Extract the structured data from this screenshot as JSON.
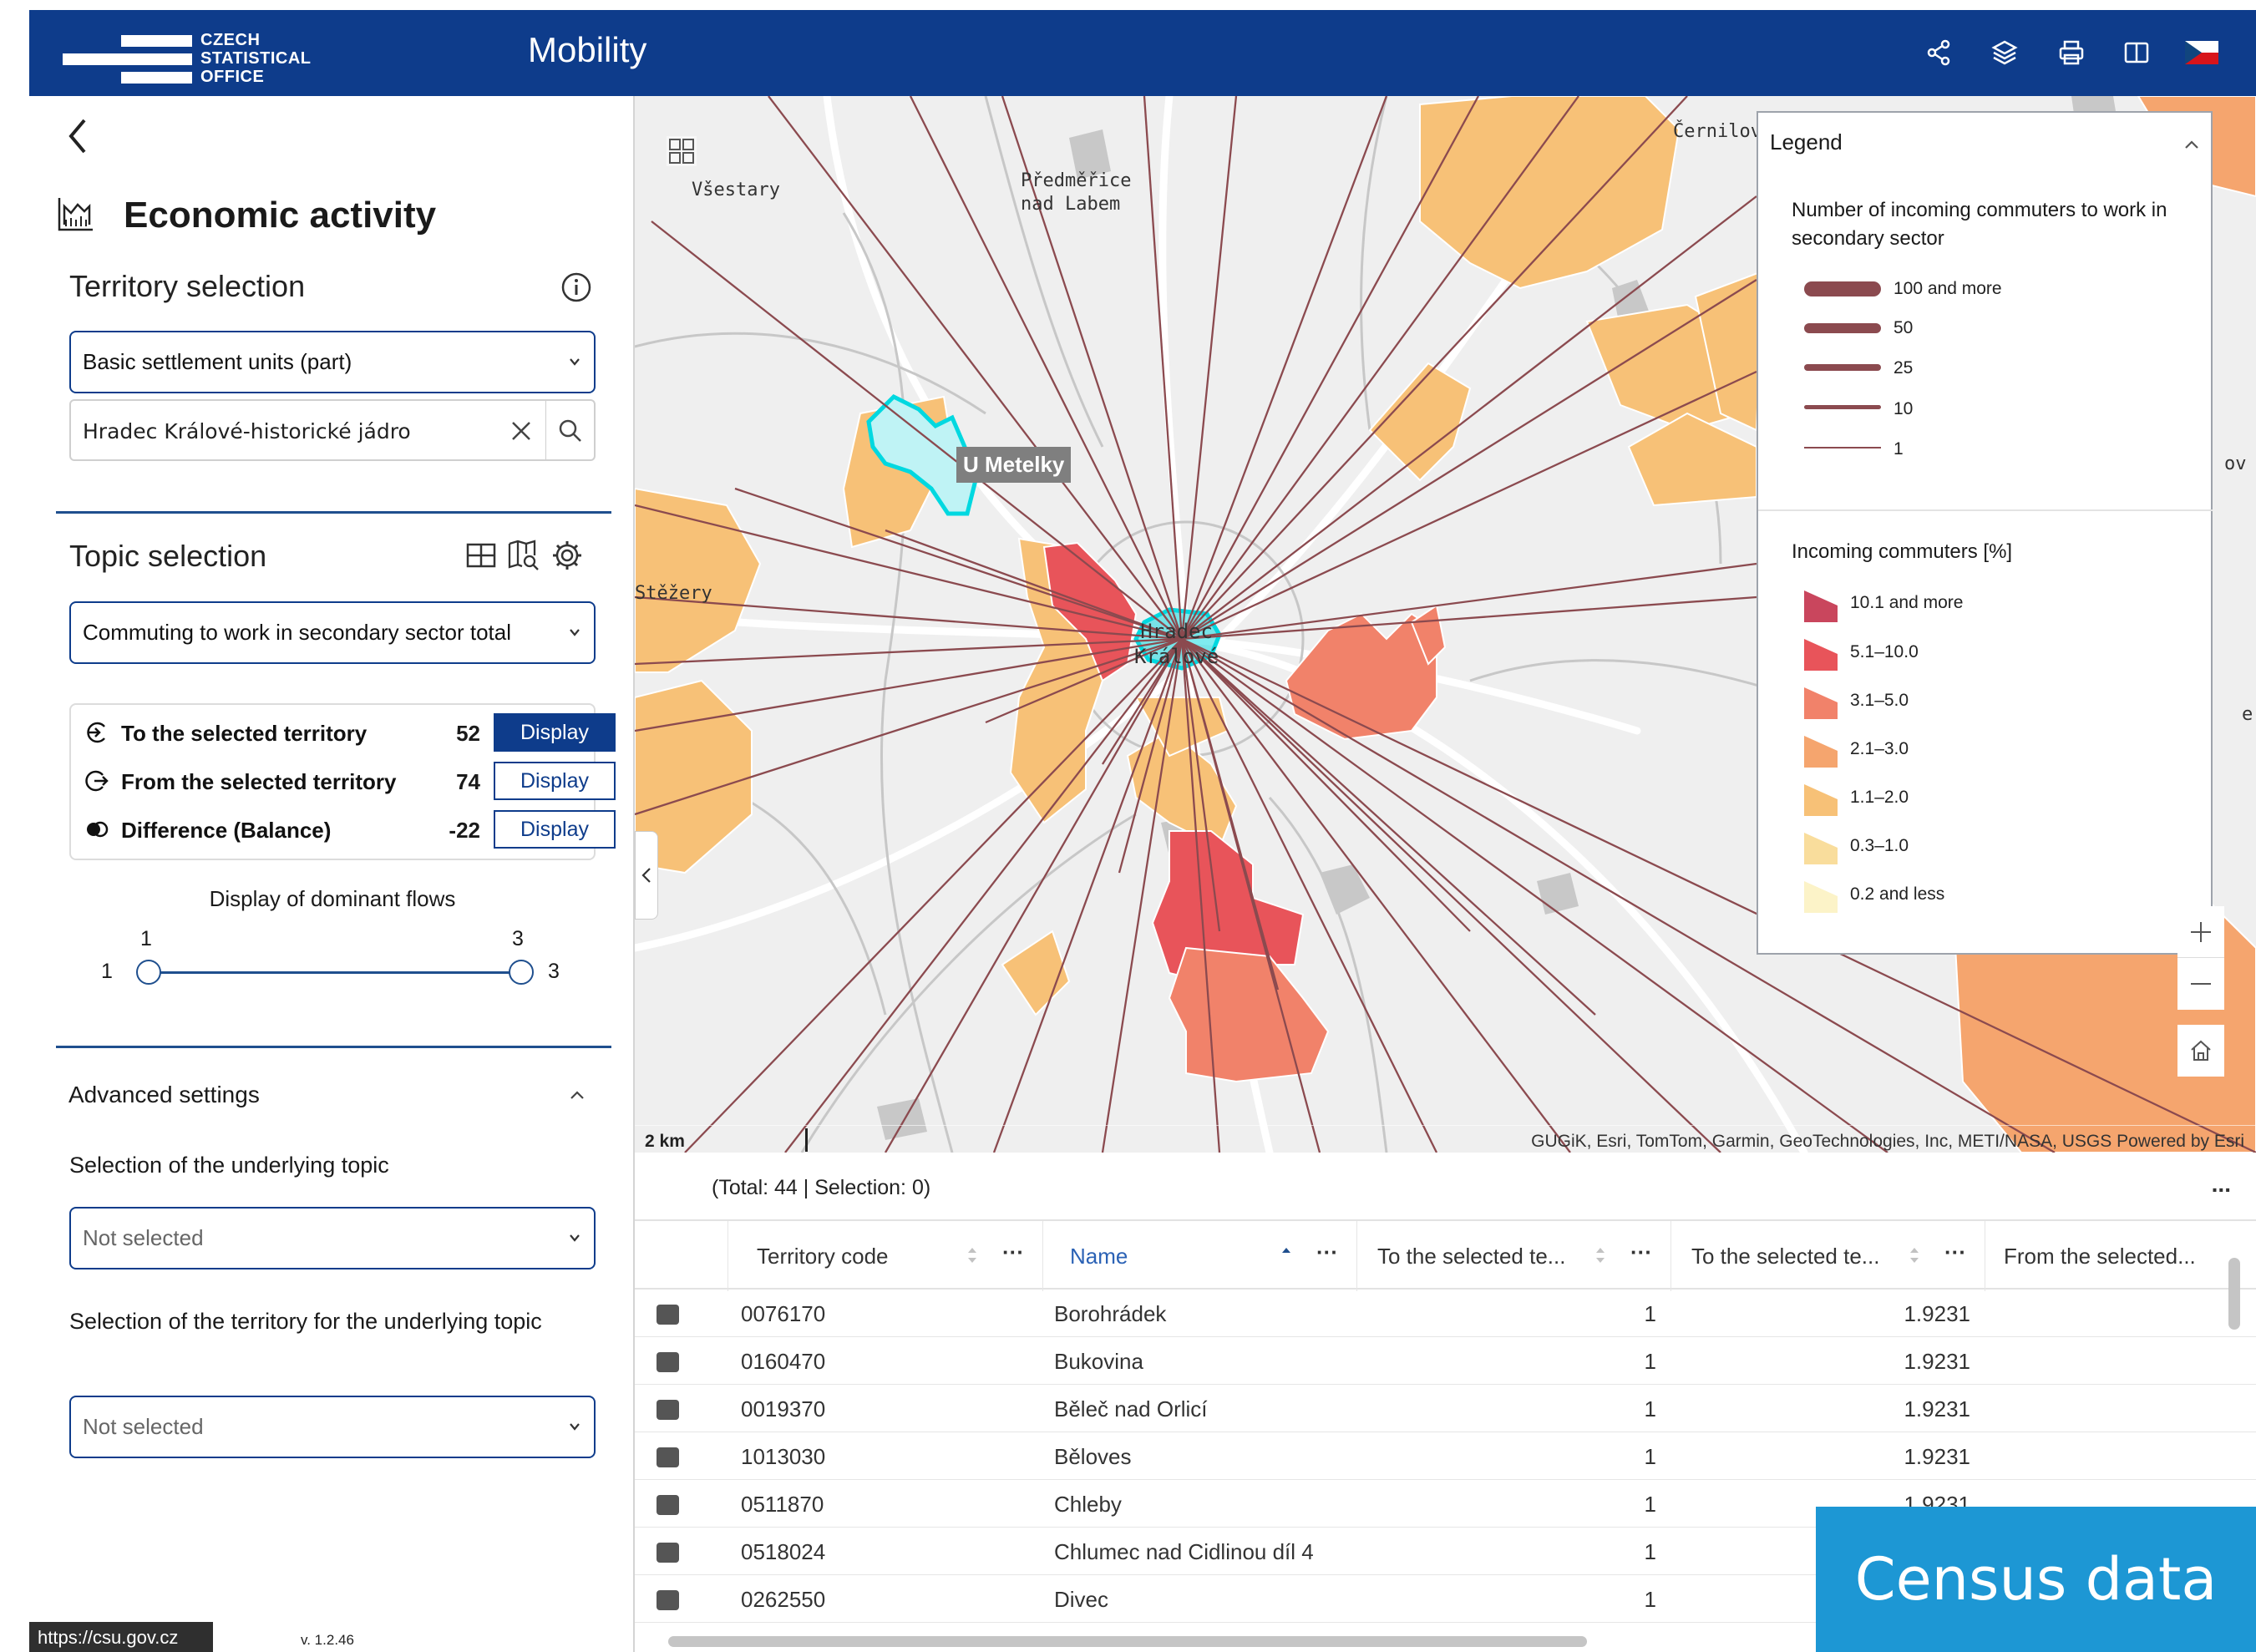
{
  "header": {
    "logo_lines": [
      "CZECH",
      "STATISTICAL",
      "OFFICE"
    ],
    "title": "Mobility",
    "icons": [
      "share-icon",
      "layers-icon",
      "print-icon",
      "book-icon",
      "czech-flag-icon"
    ]
  },
  "left_panel": {
    "back_icon": "chevron-left-icon",
    "heading": "Economic activity",
    "territory_selection": {
      "title": "Territory selection",
      "level_select": "Basic settlement units (part)",
      "search_value": "Hradec Králové-historické jádro"
    },
    "topic_selection": {
      "title": "Topic selection",
      "topic_select": "Commuting to work in secondary sector total",
      "flows": [
        {
          "label": "To the selected territory",
          "value": "52",
          "button": "Display",
          "active": true
        },
        {
          "label": "From the selected territory",
          "value": "74",
          "button": "Display",
          "active": false
        },
        {
          "label": "Difference (Balance)",
          "value": "-22",
          "button": "Display",
          "active": false
        }
      ],
      "dominant_flows": {
        "label": "Display of dominant flows",
        "min": "1",
        "max": "3",
        "low_value": "1",
        "high_value": "3",
        "low_fraction": 0,
        "high_fraction": 1
      }
    },
    "advanced": {
      "title": "Advanced settings",
      "underlying_topic_label": "Selection of the underlying topic",
      "underlying_topic_value": "Not selected",
      "underlying_territory_label": "Selection of the territory for the underlying topic",
      "underlying_territory_value": "Not selected"
    },
    "status_url": "https://csu.gov.cz",
    "version": "v. 1.2.46"
  },
  "map": {
    "places": {
      "vsestary": "Všestary",
      "predmerice": "Předměřice\nnad Labem",
      "cernilov": "Černilov",
      "stezery": "Stěžery",
      "hradec": "Hradec\nKrálové",
      "ov": "ov",
      "e_edge": "e"
    },
    "tooltip": "U Metelky",
    "scale_label": "2 km",
    "attribution": "GUGiK, Esri, TomTom, Garmin, GeoTechnologies, Inc, METI/NASA, USGS   Powered by Esri",
    "legend": {
      "title": "Legend",
      "lines_title": "Number of incoming commuters to work in secondary sector",
      "line_classes": [
        "100 and more",
        "50",
        "25",
        "10",
        "1"
      ],
      "fill_title": "Incoming commuters [%]",
      "fill_classes": [
        "10.1 and more",
        "5.1–10.0",
        "3.1–5.0",
        "2.1–3.0",
        "1.1–2.0",
        "0.3–1.0",
        "0.2 and less"
      ],
      "fill_colors": [
        "#c9465d",
        "#e8545a",
        "#f1826a",
        "#f5a56e",
        "#f7c177",
        "#f9dd9c",
        "#fcf3c8"
      ],
      "line_color": "#8b4a4f"
    },
    "controls": [
      "zoom-in-icon",
      "zoom-out-icon",
      "home-icon"
    ]
  },
  "table": {
    "summary": "(Total: 44 | Selection: 0)",
    "more": "...",
    "columns": [
      "Territory code",
      "Name",
      "To the selected te...",
      "To the selected te...",
      "From the selected..."
    ],
    "rows": [
      {
        "code": "0076170",
        "name": "Borohrádek",
        "to_count": "1",
        "to_pct": "1.9231"
      },
      {
        "code": "0160470",
        "name": "Bukovina",
        "to_count": "1",
        "to_pct": "1.9231"
      },
      {
        "code": "0019370",
        "name": "Běleč nad Orlicí",
        "to_count": "1",
        "to_pct": "1.9231"
      },
      {
        "code": "1013030",
        "name": "Běloves",
        "to_count": "1",
        "to_pct": "1.9231"
      },
      {
        "code": "0511870",
        "name": "Chleby",
        "to_count": "1",
        "to_pct": "1.9231"
      },
      {
        "code": "0518024",
        "name": "Chlumec nad Cidlinou díl 4",
        "to_count": "1",
        "to_pct": ""
      },
      {
        "code": "0262550",
        "name": "Divec",
        "to_count": "1",
        "to_pct": ""
      }
    ]
  },
  "census_badge": "Census data",
  "colors": {
    "brand": "#0e3c8b",
    "badge": "#1d97d4",
    "selection": "#00d8e0"
  }
}
